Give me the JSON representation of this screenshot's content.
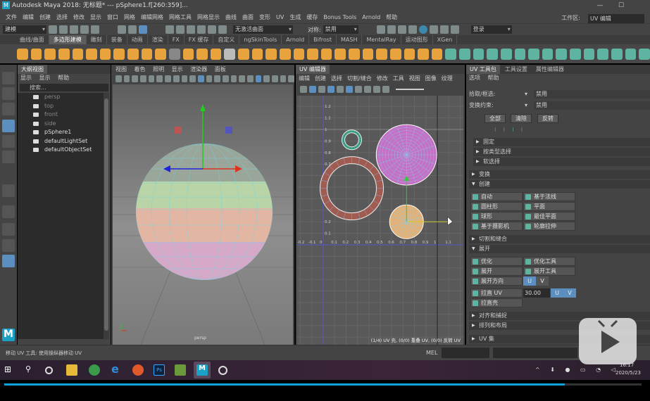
{
  "window": {
    "title": "Autodesk Maya 2018: 无标题*   ---   pSphere1.f[260:359]...",
    "logo": "M",
    "minimize": "—",
    "maximize": "☐"
  },
  "menubar": {
    "items": [
      "文件",
      "编辑",
      "创建",
      "选择",
      "修改",
      "显示",
      "窗口",
      "网格",
      "编辑网格",
      "网格工具",
      "网格显示",
      "曲线",
      "曲面",
      "变形",
      "UV",
      "生成",
      "缓存",
      "Bonus Tools",
      "Arnold",
      "帮助"
    ],
    "workspace_label": "工作区:",
    "workspace_value": "UV 编辑"
  },
  "statusline": {
    "mode": "建模",
    "no_live_surface": "无激活曲面",
    "symmetry_label": "对称:",
    "symmetry_value": "禁用",
    "login": "登录"
  },
  "shelf": {
    "tabs": [
      "曲线/曲面",
      "多边形建模",
      "雕刻",
      "装备",
      "动画",
      "渲染",
      "FX",
      "FX 缓存",
      "自定义",
      "ngSkinTools",
      "Arnold",
      "Bifrost",
      "MASH",
      "MentalRay",
      "运动图形",
      "XGen"
    ],
    "active_tab": 1
  },
  "outliner": {
    "title": "大纲视图",
    "menu": [
      "显示",
      "显示",
      "帮助"
    ],
    "search_placeholder": "搜索...",
    "items": [
      {
        "name": "persp",
        "dim": true
      },
      {
        "name": "top",
        "dim": true
      },
      {
        "name": "front",
        "dim": true
      },
      {
        "name": "side",
        "dim": true
      },
      {
        "name": "pSphere1",
        "dim": false
      },
      {
        "name": "defaultLightSet",
        "dim": false
      },
      {
        "name": "defaultObjectSet",
        "dim": false
      }
    ]
  },
  "viewport": {
    "menu": [
      "视图",
      "着色",
      "照明",
      "显示",
      "渲染器",
      "面板"
    ],
    "camera_label": "persp"
  },
  "uv_editor": {
    "title": "UV 编辑器",
    "menu": [
      "编辑",
      "创建",
      "选择",
      "切割/缝合",
      "修改",
      "工具",
      "视图",
      "图像",
      "纹理"
    ],
    "u_ticks": [
      "-0.2",
      "-0.1",
      "0",
      "0.1",
      "0.2",
      "0.3",
      "0.4",
      "0.5",
      "0.6",
      "0.7",
      "0.8",
      "0.9",
      "1",
      "1.1"
    ],
    "v_ticks": [
      "1.2",
      "1.1",
      "1",
      "0.9",
      "0.8",
      "0.7",
      "0.2",
      "0.1"
    ],
    "status": "(1/4) UV 壳, (0/0) 重叠 UV, (0/0) 反转 UV"
  },
  "uv_toolkit": {
    "tabs": [
      "UV 工具包",
      "工具设置",
      "属性编辑器"
    ],
    "menu": [
      "选项",
      "帮助"
    ],
    "pick_label": "拾取/框选:",
    "pick_value": "禁用",
    "transform_label": "变换约束:",
    "transform_value": "禁用",
    "buttons": [
      "全部",
      "清除",
      "反转"
    ],
    "sub_frames": [
      "固定",
      "按类型选择",
      "软选择"
    ],
    "frames": {
      "transform": "变换",
      "create": "创建",
      "cut_sew": "切割和缝合",
      "unfold": "展开",
      "align": "对齐和捕捉",
      "arrange": "排列和布局",
      "uvsets": "UV 集"
    },
    "create_items": [
      "自动",
      "基于法线",
      "圆柱形",
      "平面",
      "球形",
      "最佳平面",
      "基于摄影机",
      "轮廓拉伸"
    ],
    "unfold_items": [
      "优化",
      "优化工具",
      "展开",
      "展开工具",
      "展开方向",
      "拉直 UV",
      "拉直壳"
    ],
    "unfold_dir_u": "U",
    "unfold_dir_v": "V",
    "straighten_value": "30.00",
    "straighten_u": "U",
    "straighten_v": "V"
  },
  "helpline": {
    "text": "移动 UV 工具: 使用操纵器移动 UV",
    "mel": "MEL"
  },
  "taskbar": {
    "time": "16:17",
    "date": "2020/5/23"
  },
  "player": {
    "progress": 0.88
  },
  "colors": {
    "accent": "#5c8fbf",
    "progress": "#0ea2dc"
  }
}
